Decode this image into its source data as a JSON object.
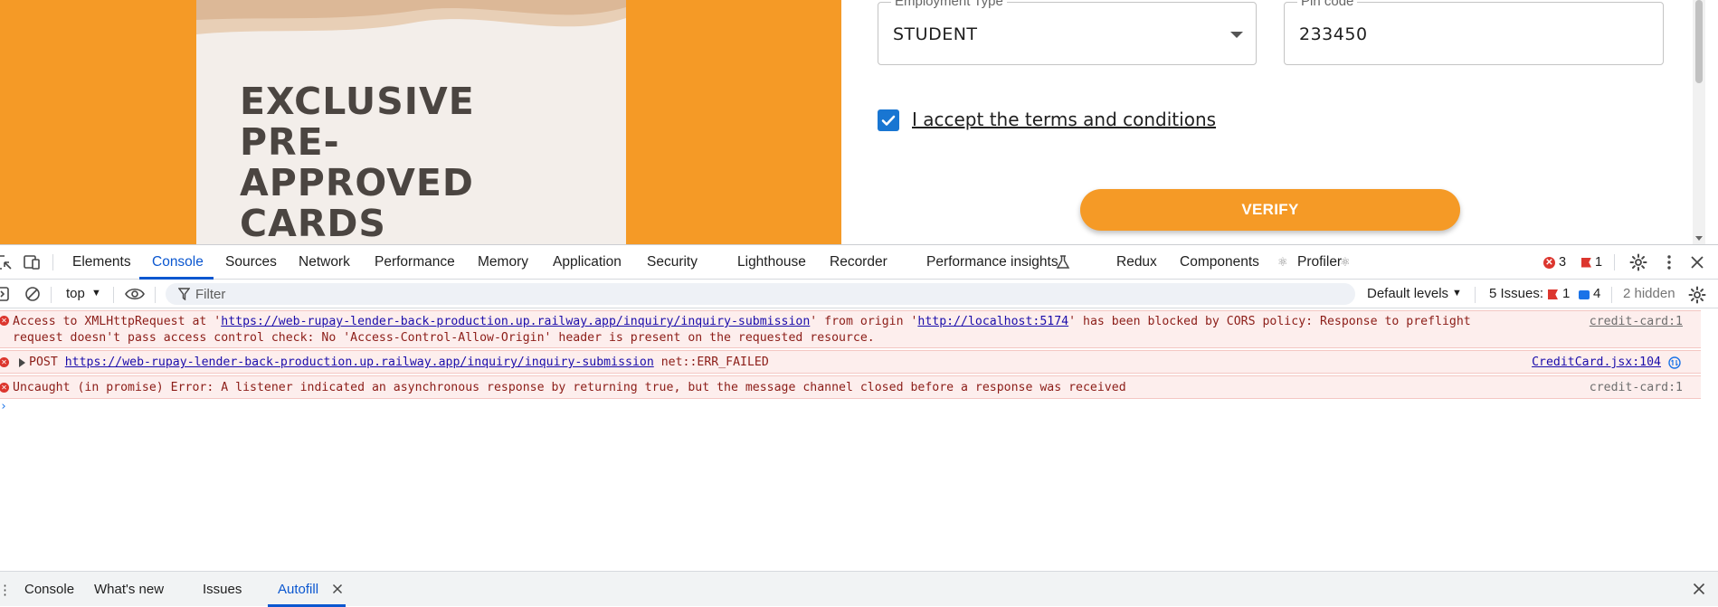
{
  "page": {
    "promo": {
      "title_lines": [
        "EXCLUSIVE",
        "PRE-",
        "APPROVED",
        "CARDS"
      ]
    },
    "form": {
      "employment_type": {
        "label": "Employment Type",
        "value": "STUDENT"
      },
      "pin_code": {
        "label": "Pin code",
        "value": "233450"
      },
      "terms": {
        "label": "I accept the terms and conditions",
        "checked": true
      },
      "verify_label": "VERIFY"
    },
    "colors": {
      "brand_orange": "#f59a26",
      "checkbox_blue": "#1976d2"
    }
  },
  "devtools": {
    "tabs": [
      "Elements",
      "Console",
      "Sources",
      "Network",
      "Performance",
      "Memory",
      "Application",
      "Security",
      "Lighthouse",
      "Recorder",
      "Performance insights",
      "Redux",
      "Components",
      "Profiler"
    ],
    "active_tab": "Console",
    "error_count": "3",
    "issue_count": "1",
    "toolbar": {
      "context": "top",
      "filter_placeholder": "Filter",
      "levels": "Default levels",
      "issues_label": "5 Issues:",
      "issues_errors": "1",
      "issues_info": "4",
      "hidden": "2 hidden"
    },
    "messages": [
      {
        "type": "error",
        "line1_prefix": "Access to XMLHttpRequest at '",
        "line1_url": "https://web-rupay-lender-back-production.up.railway.app/inquiry/inquiry-submission",
        "line1_mid": "' from origin '",
        "line1_origin": "http://localhost:5174",
        "line1_suffix": "' has been blocked by CORS policy: Response to preflight",
        "line2": "request doesn't pass access control check: No 'Access-Control-Allow-Origin' header is present on the requested resource.",
        "source": "credit-card:1"
      },
      {
        "type": "error",
        "method": "POST",
        "url": "https://web-rupay-lender-back-production.up.railway.app/inquiry/inquiry-submission",
        "status": "net::ERR_FAILED",
        "source": "CreditCard.jsx:104"
      },
      {
        "type": "error",
        "text": "Uncaught (in promise) Error: A listener indicated an asynchronous response by returning true, but the message channel closed before a response was received",
        "source": "credit-card:1"
      }
    ],
    "prompt": "›",
    "drawer_tabs": [
      "Console",
      "What's new",
      "Issues",
      "Autofill"
    ],
    "drawer_active": "Autofill"
  }
}
